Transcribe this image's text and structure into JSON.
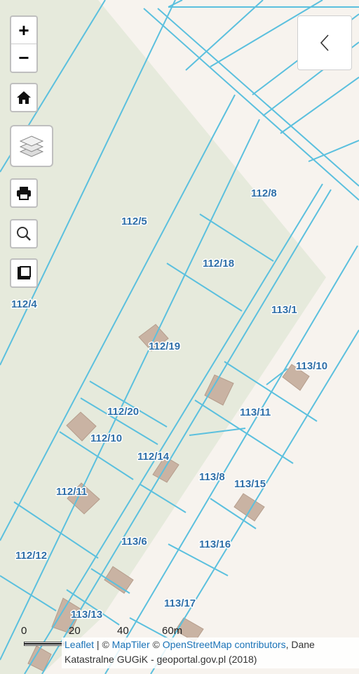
{
  "controls": {
    "zoom_in": "+",
    "zoom_out": "−",
    "home_icon": "home-icon",
    "layers_icon": "layers-icon",
    "print_icon": "printer-icon",
    "search_icon": "search-icon",
    "measure_icon": "ruler-icon",
    "panel_icon": "chevron-left-icon"
  },
  "colors": {
    "parcel_line": "#5bc0de",
    "label": "#2f6fa8",
    "forest": "#e6eadc",
    "background": "#f7f3ee",
    "building": "#c9b3a3"
  },
  "parcels": [
    {
      "id": "112/4",
      "label": "112/4"
    },
    {
      "id": "112/5",
      "label": "112/5"
    },
    {
      "id": "112/8",
      "label": "112/8"
    },
    {
      "id": "112/18",
      "label": "112/18"
    },
    {
      "id": "113/1",
      "label": "113/1"
    },
    {
      "id": "112/19",
      "label": "112/19"
    },
    {
      "id": "113/10",
      "label": "113/10"
    },
    {
      "id": "112/20",
      "label": "112/20"
    },
    {
      "id": "113/11",
      "label": "113/11"
    },
    {
      "id": "112/10",
      "label": "112/10"
    },
    {
      "id": "112/14",
      "label": "112/14"
    },
    {
      "id": "113/8",
      "label": "113/8"
    },
    {
      "id": "113/15",
      "label": "113/15"
    },
    {
      "id": "112/11",
      "label": "112/11"
    },
    {
      "id": "113/6",
      "label": "113/6"
    },
    {
      "id": "113/16",
      "label": "113/16"
    },
    {
      "id": "112/12",
      "label": "112/12"
    },
    {
      "id": "113/17",
      "label": "113/17"
    },
    {
      "id": "113/13",
      "label": "113/13"
    }
  ],
  "scale": {
    "ticks": [
      "0",
      "20",
      "40",
      "60m"
    ]
  },
  "attribution": {
    "leaflet": "Leaflet",
    "sep1": " | © ",
    "maptiler": "MapTiler",
    "sep2": " © ",
    "osm": "OpenStreetMap contributors",
    "tail": ", Dane Katastralne GUGiK - geoportal.gov.pl (2018)"
  }
}
